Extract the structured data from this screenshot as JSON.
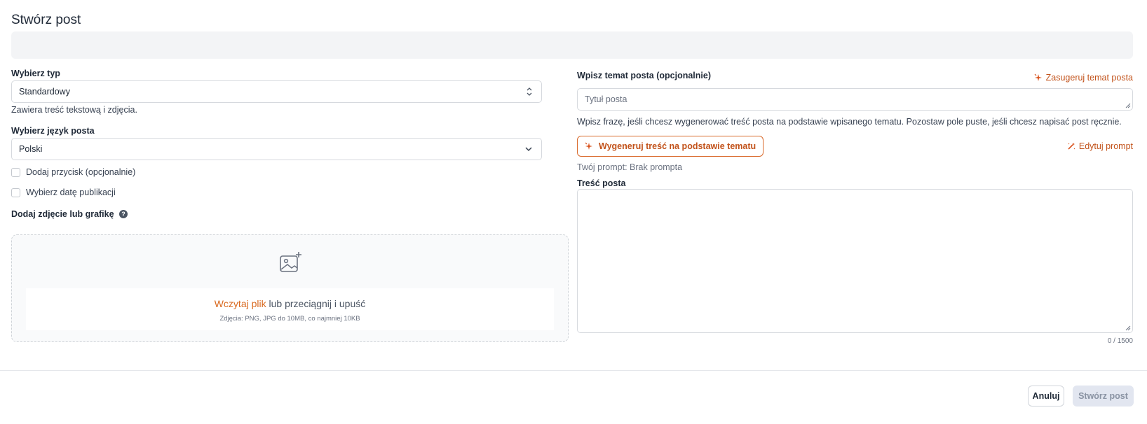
{
  "page": {
    "title": "Stwórz post"
  },
  "left": {
    "type_label": "Wybierz typ",
    "type_value": "Standardowy",
    "type_hint": "Zawiera treść tekstową i zdjęcia.",
    "language_label": "Wybierz język posta",
    "language_value": "Polski",
    "add_button_label": "Dodaj przycisk (opcjonalnie)",
    "add_button_checked": false,
    "publish_date_label": "Wybierz datę publikacji",
    "publish_date_checked": false,
    "image_label": "Dodaj zdjęcie lub grafikę",
    "upload": {
      "link": "Wczytaj plik",
      "text": " lub przeciągnij i upuść",
      "hint": "Zdjęcia: PNG, JPG do 10MB, co najmniej 10KB"
    }
  },
  "right": {
    "topic_label": "Wpisz temat posta (opcjonalnie)",
    "suggest_label": "Zasugeruj temat posta",
    "topic_placeholder": "Tytuł posta",
    "topic_hint": "Wpisz frazę, jeśli chcesz wygenerować treść posta na podstawie wpisanego tematu. Pozostaw pole puste, jeśli chcesz napisać post ręcznie.",
    "generate_label": "Wygeneruj treść na podstawie tematu",
    "edit_prompt_label": "Edytuj prompt",
    "prompt_status": "Twój prompt: Brak prompta",
    "content_label": "Treść posta",
    "content_value": "",
    "counter": "0 / 1500"
  },
  "footer": {
    "cancel_label": "Anuluj",
    "create_label": "Stwórz post"
  },
  "colors": {
    "accent": "#c2521a",
    "upload_link": "#d9691f",
    "banner": "#f3f4f6",
    "create_disabled_bg": "#e2e6f0"
  },
  "icons": {
    "select_arrows": "chevron-up-down-icon",
    "dropdown": "chevron-down-icon",
    "help": "question-circle-icon",
    "image_upload": "image-plus-icon",
    "sparkles": "sparkle-icon",
    "edit_sparkle": "magic-wand-icon"
  }
}
